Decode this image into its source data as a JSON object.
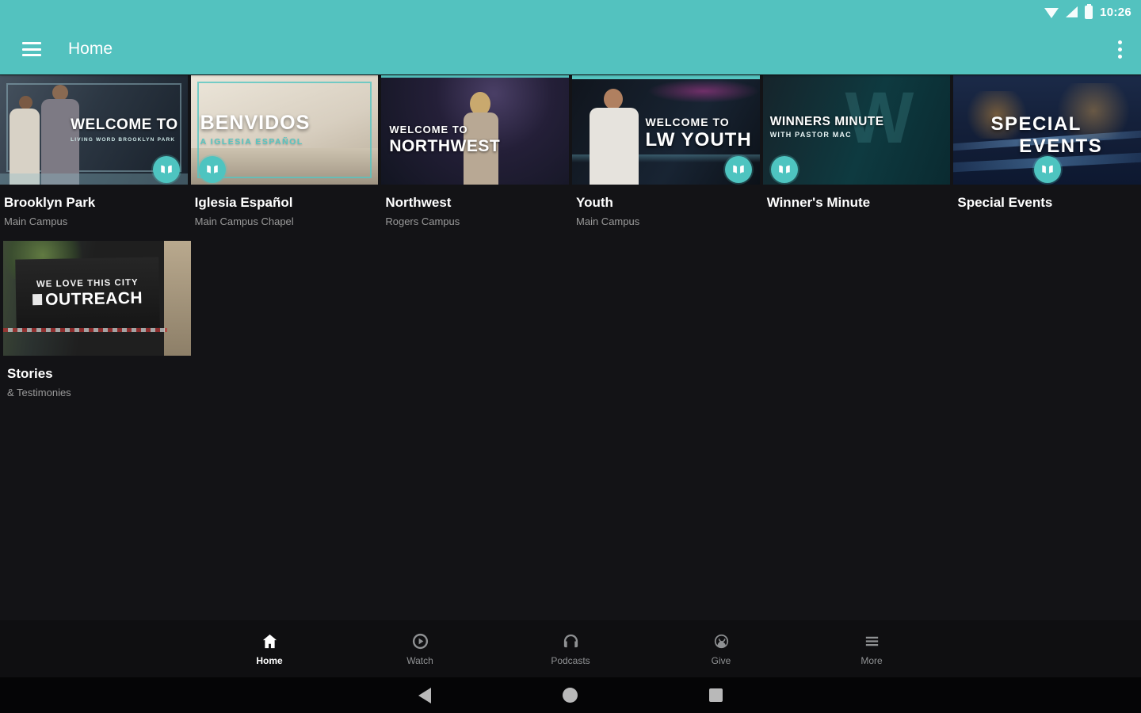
{
  "status_bar": {
    "time": "10:26",
    "icons": [
      "wifi-icon",
      "cellular-signal-icon",
      "battery-icon"
    ]
  },
  "app_bar": {
    "title": "Home",
    "icons": [
      "menu-icon",
      "overflow-menu-icon"
    ]
  },
  "home_grid": {
    "cards": [
      {
        "title": "Brooklyn Park",
        "subtitle": "Main Campus",
        "overlay": {
          "line1": "WELCOME TO",
          "line2": "LIVING WORD BROOKLYN PARK"
        },
        "badge": "open-book"
      },
      {
        "title": "Iglesia Español",
        "subtitle": "Main Campus Chapel",
        "overlay": {
          "line1": "BENVIDOS",
          "line2": "A IGLESIA ESPAÑOL"
        },
        "badge": "open-book"
      },
      {
        "title": "Northwest",
        "subtitle": "Rogers Campus",
        "overlay": {
          "line1": "WELCOME TO",
          "line2": "NORTHWEST"
        },
        "badge": ""
      },
      {
        "title": "Youth",
        "subtitle": "Main Campus",
        "overlay": {
          "line1": "WELCOME TO",
          "line2": "LW YOUTH"
        },
        "badge": "open-book"
      },
      {
        "title": "Winner's Minute",
        "subtitle": "",
        "overlay": {
          "line1": "WINNERS MINUTE",
          "line2": "WITH PASTOR MAC"
        },
        "badge": "open-book"
      },
      {
        "title": "Special Events",
        "subtitle": "",
        "overlay": {
          "line1": "SPECIAL",
          "line2": "EVENTS"
        },
        "badge": "open-book"
      },
      {
        "title": "Stories",
        "subtitle": "& Testimonies",
        "overlay": {
          "line1": "WE LOVE THIS CITY",
          "line2": "OUTREACH"
        },
        "badge": ""
      }
    ]
  },
  "bottom_nav": {
    "items": [
      {
        "label": "Home",
        "icon": "home-icon",
        "active": true
      },
      {
        "label": "Watch",
        "icon": "watch-icon",
        "active": false
      },
      {
        "label": "Podcasts",
        "icon": "podcasts-icon",
        "active": false
      },
      {
        "label": "Give",
        "icon": "give-icon",
        "active": false
      },
      {
        "label": "More",
        "icon": "more-icon",
        "active": false
      }
    ]
  },
  "android_nav": {
    "buttons": [
      "back",
      "home",
      "recents"
    ]
  },
  "colors": {
    "accent_teal": "#53c2bf",
    "background": "#131316",
    "inactive_gray": "#8f9193"
  }
}
